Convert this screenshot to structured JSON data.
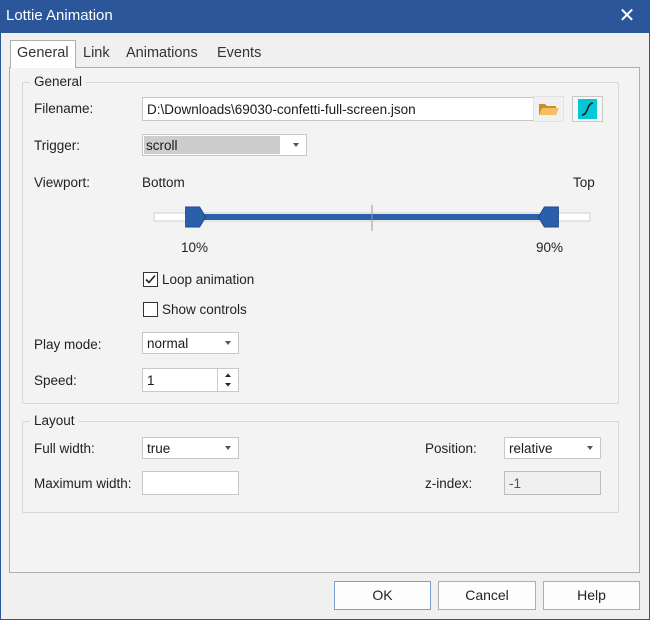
{
  "window": {
    "title": "Lottie Animation",
    "close_glyph": "✕"
  },
  "tabs": [
    {
      "label": "General",
      "active": true
    },
    {
      "label": "Link"
    },
    {
      "label": "Animations"
    },
    {
      "label": "Events"
    }
  ],
  "general": {
    "group_title": "General",
    "filename": {
      "label": "Filename:",
      "value": "D:\\Downloads\\69030-confetti-full-screen.json"
    },
    "trigger": {
      "label": "Trigger:",
      "value": "scroll"
    },
    "viewport": {
      "label": "Viewport:",
      "left_label": "Bottom",
      "right_label": "Top",
      "start_percent": 10,
      "end_percent": 90,
      "start_text": "10%",
      "end_text": "90%"
    },
    "loop_animation": {
      "label": "Loop animation",
      "checked": true
    },
    "show_controls": {
      "label": "Show controls",
      "checked": false
    },
    "play_mode": {
      "label": "Play mode:",
      "value": "normal"
    },
    "speed": {
      "label": "Speed:",
      "value": "1"
    }
  },
  "layout": {
    "group_title": "Layout",
    "full_width": {
      "label": "Full width:",
      "value": "true"
    },
    "maximum_width": {
      "label": "Maximum width:",
      "value": ""
    },
    "position": {
      "label": "Position:",
      "value": "relative"
    },
    "z_index": {
      "label": "z-index:",
      "value": "-1"
    }
  },
  "buttons": {
    "ok": "OK",
    "cancel": "Cancel",
    "help": "Help"
  },
  "colors": {
    "titlebar": "#2b579a",
    "slider": "#2b5faa",
    "accent_cyan": "#00c8d7",
    "folder": "#e8b04b"
  }
}
